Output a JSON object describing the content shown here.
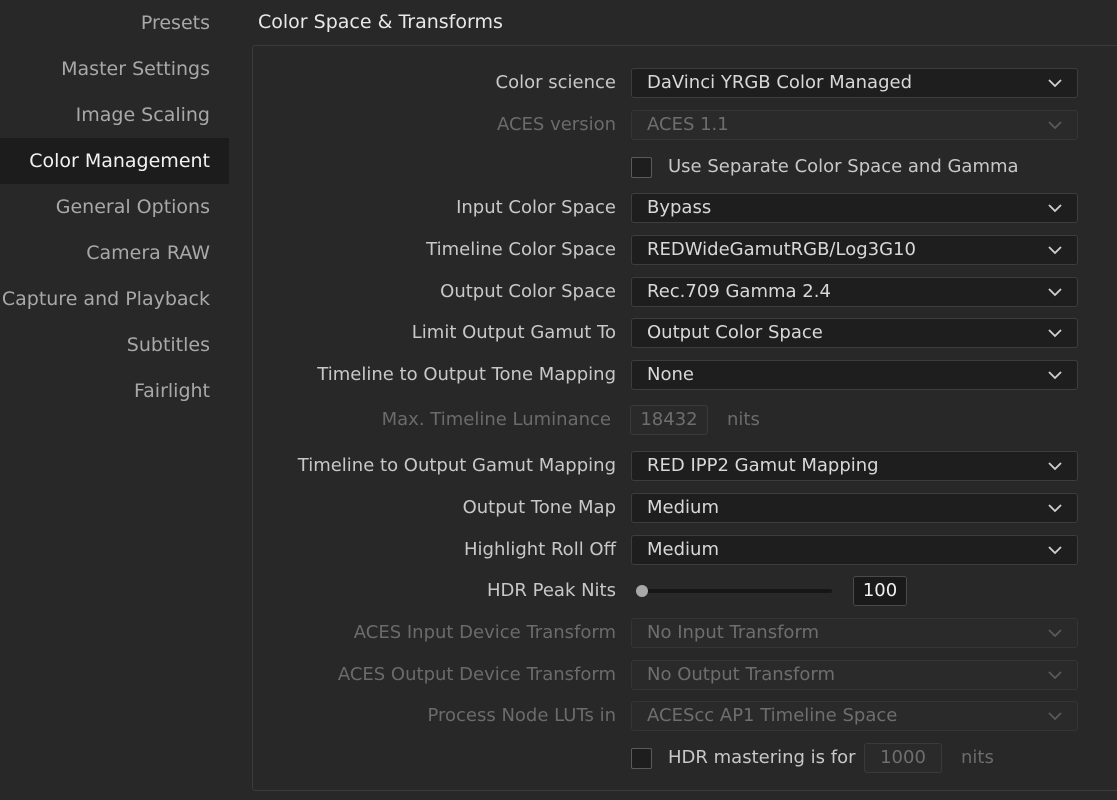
{
  "sidebar": {
    "items": [
      {
        "label": "Presets",
        "active": false
      },
      {
        "label": "Master Settings",
        "active": false
      },
      {
        "label": "Image Scaling",
        "active": false
      },
      {
        "label": "Color Management",
        "active": true
      },
      {
        "label": "General Options",
        "active": false
      },
      {
        "label": "Camera RAW",
        "active": false
      },
      {
        "label": "Capture and Playback",
        "active": false
      },
      {
        "label": "Subtitles",
        "active": false
      },
      {
        "label": "Fairlight",
        "active": false
      }
    ]
  },
  "panel": {
    "title": "Color Space & Transforms",
    "color_science": {
      "label": "Color science",
      "value": "DaVinci YRGB Color Managed"
    },
    "aces_version": {
      "label": "ACES version",
      "value": "ACES 1.1"
    },
    "separate_color_space": {
      "label": "Use Separate Color Space and Gamma",
      "checked": false
    },
    "input_color_space": {
      "label": "Input Color Space",
      "value": "Bypass"
    },
    "timeline_color_space": {
      "label": "Timeline Color Space",
      "value": "REDWideGamutRGB/Log3G10"
    },
    "output_color_space": {
      "label": "Output Color Space",
      "value": "Rec.709 Gamma 2.4"
    },
    "limit_output_gamut": {
      "label": "Limit Output Gamut To",
      "value": "Output Color Space"
    },
    "tone_mapping": {
      "label": "Timeline to Output Tone Mapping",
      "value": "None"
    },
    "max_luminance": {
      "label": "Max. Timeline Luminance",
      "value": "18432",
      "unit": "nits"
    },
    "gamut_mapping": {
      "label": "Timeline to Output Gamut Mapping",
      "value": "RED IPP2 Gamut Mapping"
    },
    "output_tone_map": {
      "label": "Output Tone Map",
      "value": "Medium"
    },
    "highlight_roll_off": {
      "label": "Highlight Roll Off",
      "value": "Medium"
    },
    "hdr_peak_nits": {
      "label": "HDR Peak Nits",
      "value": "100",
      "slider_fraction": 0.0
    },
    "aces_idt": {
      "label": "ACES Input Device Transform",
      "value": "No Input Transform"
    },
    "aces_odt": {
      "label": "ACES Output Device Transform",
      "value": "No Output Transform"
    },
    "process_node_luts": {
      "label": "Process Node LUTs in",
      "value": "ACEScc AP1 Timeline Space"
    },
    "hdr_mastering": {
      "label": "HDR mastering is for",
      "value": "1000",
      "unit": "nits",
      "checked": false
    }
  },
  "icons": {
    "dropdown": "chevron-down-icon",
    "slider": "slider-thumb"
  },
  "colors": {
    "background": "#282828",
    "active_nav_bg": "#1c1c1c",
    "dropdown_bg": "#1e1e1e",
    "text": "#c8c8c8",
    "disabled_text": "#6b6b6b"
  }
}
